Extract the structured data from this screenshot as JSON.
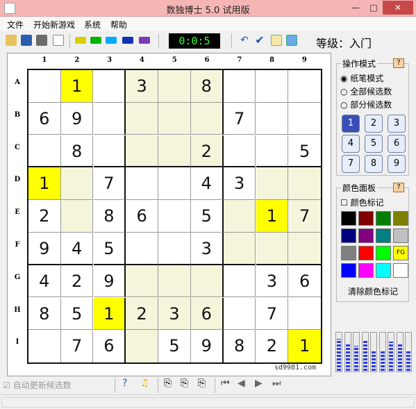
{
  "window": {
    "title": "数独博士 5.0 试用版",
    "min": "—",
    "max": "□",
    "close": "✕"
  },
  "menu": [
    "文件",
    "开始新游戏",
    "系统",
    "帮助"
  ],
  "toolbar": {
    "timer": "0:0:5",
    "level": "等级：入门"
  },
  "board": {
    "columns": [
      "1",
      "2",
      "3",
      "4",
      "5",
      "6",
      "7",
      "8",
      "9"
    ],
    "rows": [
      "A",
      "B",
      "C",
      "D",
      "E",
      "F",
      "G",
      "H",
      "I"
    ],
    "cells": [
      [
        "",
        "1",
        "",
        "3",
        "",
        "8",
        "",
        "",
        ""
      ],
      [
        "6",
        "9",
        "",
        "",
        "",
        "",
        "7",
        "",
        ""
      ],
      [
        "",
        "8",
        "",
        "",
        "",
        "2",
        "",
        "",
        "5"
      ],
      [
        "1",
        "",
        "7",
        "",
        "",
        "4",
        "3",
        "",
        ""
      ],
      [
        "2",
        "",
        "8",
        "6",
        "",
        "5",
        "",
        "1",
        "7"
      ],
      [
        "9",
        "4",
        "5",
        "",
        "",
        "3",
        "",
        "",
        ""
      ],
      [
        "4",
        "2",
        "9",
        "",
        "",
        "",
        "",
        "3",
        "6"
      ],
      [
        "8",
        "5",
        "1",
        "2",
        "3",
        "6",
        "",
        "7",
        ""
      ],
      [
        "",
        "7",
        "6",
        "",
        "5",
        "9",
        "8",
        "2",
        "1"
      ]
    ],
    "yellow": [
      [
        0,
        1
      ],
      [
        3,
        0
      ],
      [
        4,
        7
      ],
      [
        7,
        2
      ],
      [
        8,
        8
      ]
    ],
    "beige": [
      [
        0,
        3
      ],
      [
        0,
        4
      ],
      [
        0,
        5
      ],
      [
        1,
        3
      ],
      [
        1,
        4
      ],
      [
        1,
        5
      ],
      [
        2,
        3
      ],
      [
        2,
        4
      ],
      [
        2,
        5
      ],
      [
        3,
        1
      ],
      [
        3,
        7
      ],
      [
        3,
        8
      ],
      [
        4,
        1
      ],
      [
        4,
        6
      ],
      [
        4,
        8
      ],
      [
        5,
        6
      ],
      [
        5,
        7
      ],
      [
        5,
        8
      ],
      [
        6,
        3
      ],
      [
        6,
        4
      ],
      [
        6,
        5
      ],
      [
        7,
        3
      ],
      [
        7,
        4
      ],
      [
        7,
        5
      ],
      [
        8,
        3
      ]
    ],
    "watermark": "sd9981.com"
  },
  "mode_panel": {
    "title": "操作模式",
    "help": "?",
    "options": [
      "纸笔模式",
      "全部候选数",
      "部分候选数"
    ],
    "selected_option": "纸笔模式",
    "numbers": [
      "1",
      "2",
      "3",
      "4",
      "5",
      "6",
      "7",
      "8",
      "9"
    ],
    "active_number": "1"
  },
  "color_panel": {
    "title": "颜色面板",
    "help": "?",
    "checkbox_label": "颜色标记",
    "colors": [
      "#000000",
      "#800000",
      "#008000",
      "#808000",
      "#000080",
      "#800080",
      "#008080",
      "#c0c0c0",
      "#808080",
      "#ff0000",
      "#00ff00",
      "#ffff00",
      "#0000ff",
      "#ff00ff",
      "#00ffff",
      "#ffffff"
    ],
    "fg_label": "FG",
    "clear_label": "清除颜色标记"
  },
  "bottom": {
    "auto_update": "自动更新候选数"
  },
  "meter_levels": [
    0.82,
    0.68,
    0.64,
    0.79,
    0.52,
    0.52,
    0.75,
    0.68,
    0.52
  ]
}
